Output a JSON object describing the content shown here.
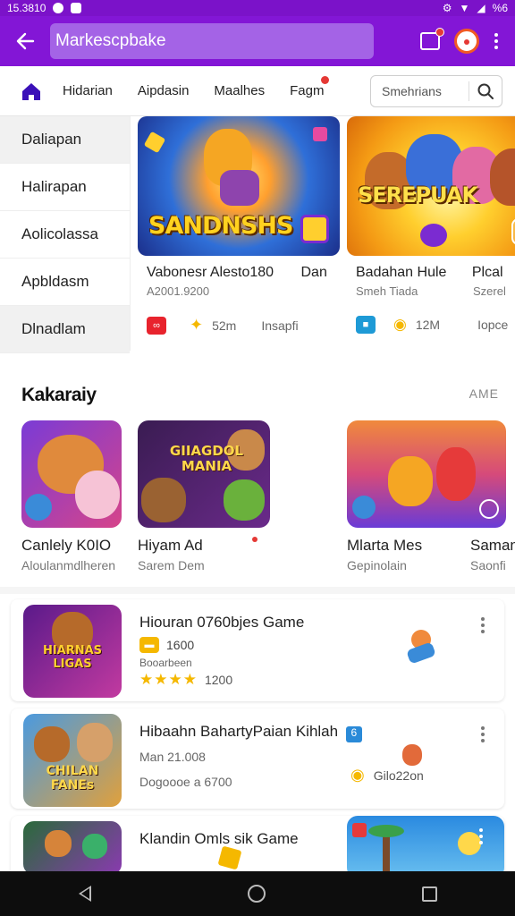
{
  "status_bar": {
    "time": "15.3810",
    "battery": "%6"
  },
  "app_bar": {
    "search_text": "Markescpbake",
    "icons": [
      "back-arrow-icon",
      "gift-icon",
      "avatar-icon",
      "more-vert-icon"
    ],
    "accent_color": "#8316d6"
  },
  "tabs": {
    "home_icon": "home-icon",
    "items": [
      {
        "label": "Hidarian"
      },
      {
        "label": "Aipdasin"
      },
      {
        "label": "Maalhes"
      },
      {
        "label": "Fagm"
      }
    ],
    "search_placeholder": "Smehrians"
  },
  "categories": [
    {
      "label": "Daliapan"
    },
    {
      "label": "Halirapan"
    },
    {
      "label": "Aolicolassa"
    },
    {
      "label": "Apbldasm"
    },
    {
      "label": "Dlnadlam"
    }
  ],
  "featured": [
    {
      "art_title": "SANDNSHS",
      "title": "Vabonesr Alesto180",
      "title_extra": "Dan",
      "subtitle": "A2001.9200",
      "stat_value": "52m",
      "stat_label": "Insapfi"
    },
    {
      "art_title": "SEREPUAK",
      "title": "Badahan Hule",
      "title_extra": "Plcal",
      "subtitle": "Smeh Tiada",
      "subtitle_extra": "Szerel",
      "stat_value": "12M",
      "stat_label": "Iopce"
    }
  ],
  "section": {
    "title": "Kakaraiy",
    "more_label": "AME"
  },
  "tiles": [
    {
      "name": "Canlely K0IO",
      "sub": "Aloulanmdlheren"
    },
    {
      "name": "Hiyam Ad",
      "sub": "Sarem Dem",
      "art_text": "GIIAGDOL MANIA"
    },
    {
      "name": "Mlarta Mes",
      "sub": "Gepinolain"
    },
    {
      "name": "Saman",
      "sub": "Saonfi"
    }
  ],
  "list_items": [
    {
      "title": "Hiouran 0760bjes Game",
      "badge_value": "1600",
      "line2": "Booarbeen",
      "rating_stars": "★★★★",
      "rating_value": "1200",
      "art_text": "HIARNAS LIGAS"
    },
    {
      "title": "Hibaahn BahartyPaian Kihlah",
      "title_badge": "6",
      "line1": "Man 21.008",
      "line2": "Dogoooe a 6700",
      "side_label": "Gilo22on",
      "art_text": "CHILAN FANEs"
    },
    {
      "title": "Klandin Omls sik Game"
    }
  ]
}
